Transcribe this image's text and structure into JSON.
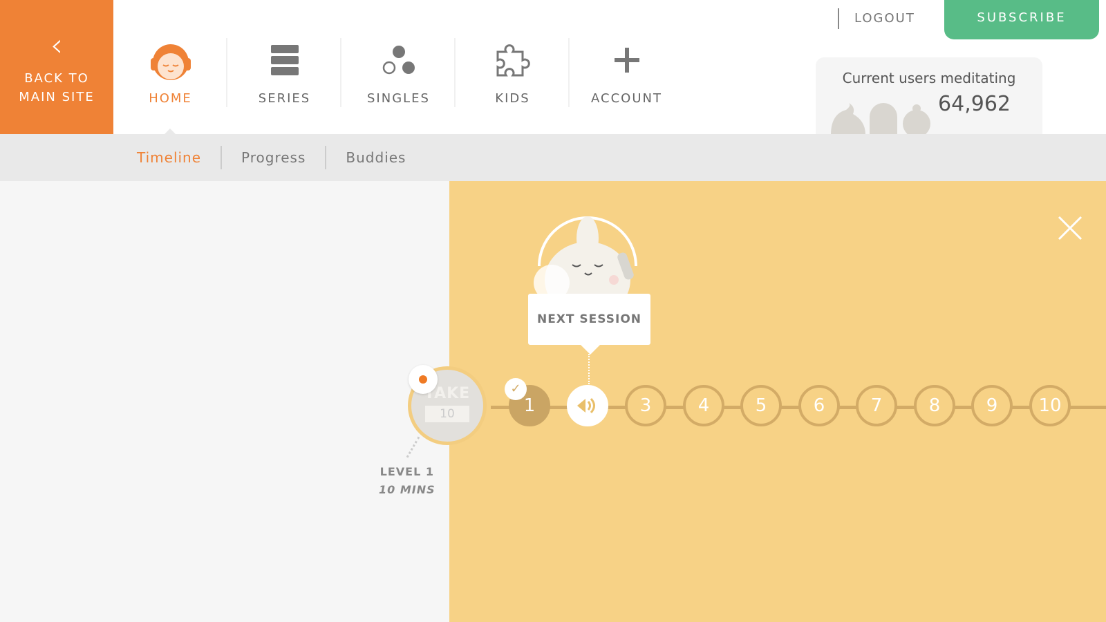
{
  "back": {
    "label": "BACK TO\nMAIN SITE",
    "icon": "chevron-left-icon"
  },
  "nav": [
    {
      "label": "HOME",
      "icon": "headspace-character-icon",
      "active": true
    },
    {
      "label": "SERIES",
      "icon": "stack-icon"
    },
    {
      "label": "SINGLES",
      "icon": "circles-icon"
    },
    {
      "label": "KIDS",
      "icon": "puzzle-icon"
    },
    {
      "label": "ACCOUNT",
      "icon": "plus-icon"
    }
  ],
  "header": {
    "logout": "LOGOUT",
    "subscribe": "SUBSCRIBE"
  },
  "users": {
    "title": "Current users meditating",
    "count": "64,962"
  },
  "tabs": [
    {
      "label": "Timeline",
      "active": true
    },
    {
      "label": "Progress"
    },
    {
      "label": "Buddies"
    }
  ],
  "timeline": {
    "pack": {
      "title": "TAKE",
      "number": "10"
    },
    "level": "LEVEL 1",
    "duration": "10 MINS",
    "next_session": "NEXT SESSION",
    "sessions": [
      "1",
      "",
      "3",
      "4",
      "5",
      "6",
      "7",
      "8",
      "9",
      "10"
    ],
    "completed": [
      "1"
    ],
    "current_icon": "speaker-icon"
  },
  "colors": {
    "accent": "#ef8236",
    "subscribe": "#58bc87",
    "panel": "#f7d286",
    "node": "#d3ab66"
  }
}
